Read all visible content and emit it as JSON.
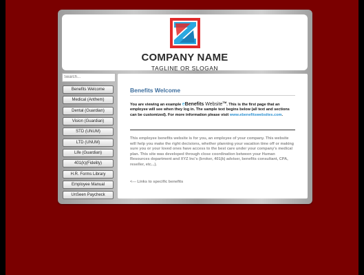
{
  "header": {
    "company_name": "COMPANY NAME",
    "tagline": "TAGLINE OR SLOGAN"
  },
  "search": {
    "placeholder": "Search..."
  },
  "nav": {
    "items": [
      {
        "label": "Benefits Welcome"
      },
      {
        "label": "Medical (Anthem)"
      },
      {
        "label": "Dental (Guardian)"
      },
      {
        "label": "Vision (Guardian)"
      },
      {
        "label": "STD (UNUM)"
      },
      {
        "label": "LTD (UNUM)"
      },
      {
        "label": "Life (Guardian)"
      },
      {
        "label": "401(k)(Fidelity)"
      },
      {
        "label": "H.R. Forms Library"
      },
      {
        "label": "Employee Manual"
      },
      {
        "label": "UnSeen Paycheck"
      }
    ]
  },
  "content": {
    "heading": "Benefits Welcome",
    "intro_pre": "You are viewing an example ",
    "brand_e": "e",
    "brand_name": "Benefits",
    "brand_suffix": " Website",
    "brand_tm": "TM",
    "intro_post": ". This is the first page that an employee will see when they log in. The sample text begins below (all text and sections can be customized). For more information please visit ",
    "intro_link": "www.ebenefitswebsites.com",
    "intro_end": ".",
    "body": "This employee benefits website is for you, an employee of your company. This website will help you make the right decisions, whether planning your vacation time off or making sure you or your loved ones have access to the best care under your company's medical plan. This site was developed through close coordination between your Human Resources department and XYZ Inc's (broker, 401(k) adviser, benefits consultant, CPA, reseller, etc...).",
    "links_note": "<--- Links to specific benefits"
  },
  "colors": {
    "outer_background": "#7a0000",
    "heading": "#3d6e9e",
    "link": "#2a8fd0",
    "logo_red": "#e02a2a",
    "logo_blue": "#2aa8e0"
  }
}
